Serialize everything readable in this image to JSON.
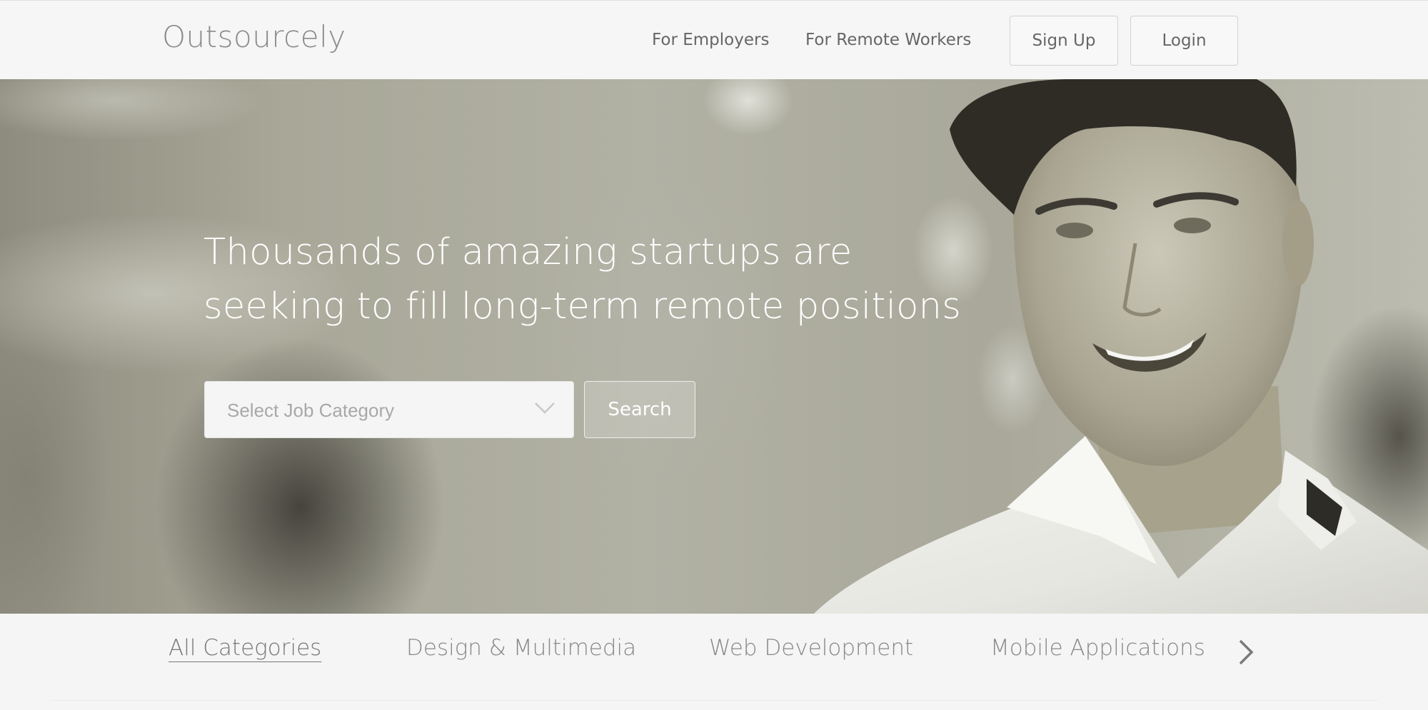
{
  "header": {
    "logo": "Outsourcely",
    "nav": {
      "employers": "For Employers",
      "remote_workers": "For Remote Workers"
    },
    "signup_label": "Sign Up",
    "login_label": "Login"
  },
  "hero": {
    "headline_line1": "Thousands of amazing startups are",
    "headline_line2": "seeking to fill long-term remote positions",
    "category_select": {
      "placeholder": "Select Job Category"
    },
    "search_label": "Search"
  },
  "categories": {
    "items": [
      {
        "label": "All Categories",
        "active": true
      },
      {
        "label": "Design & Multimedia",
        "active": false
      },
      {
        "label": "Web Development",
        "active": false
      },
      {
        "label": "Mobile Applications",
        "active": false
      }
    ],
    "next_icon": "chevron-right-icon"
  },
  "colors": {
    "header_bg": "#f6f6f6",
    "hero_text": "#ffffff",
    "nav_text": "#666666",
    "category_text": "#888888"
  }
}
